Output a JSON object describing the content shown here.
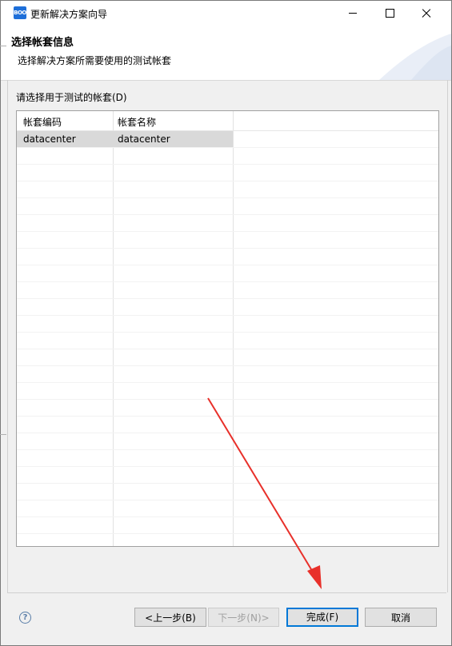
{
  "window": {
    "icon_text": "BOO",
    "title": "更新解决方案向导"
  },
  "header": {
    "title": "选择帐套信息",
    "description": "选择解决方案所需要使用的测试帐套"
  },
  "main": {
    "prompt": "请选择用于测试的帐套(D)",
    "table": {
      "columns": [
        "帐套编码",
        "帐套名称"
      ],
      "rows": [
        {
          "code": "datacenter",
          "name": "datacenter",
          "selected": true
        }
      ]
    }
  },
  "footer": {
    "help_icon": "?",
    "back_label": "<上一步(B)",
    "next_label": "下一步(N)>",
    "finish_label": "完成(F)",
    "cancel_label": "取消"
  },
  "annotation": {
    "arrow_color": "#e8302a"
  }
}
